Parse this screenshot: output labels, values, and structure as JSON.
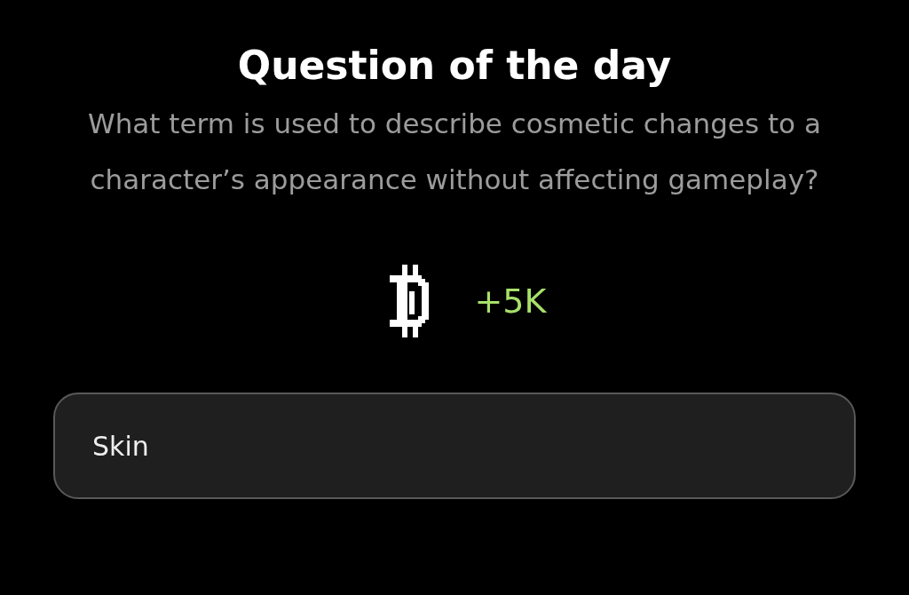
{
  "title": "Question of the day",
  "question": "What term is used to describe cosmetic changes to a character’s appearance without affecting gameplay?",
  "reward": {
    "amount": "+5K"
  },
  "answer": {
    "value": "Skin"
  }
}
